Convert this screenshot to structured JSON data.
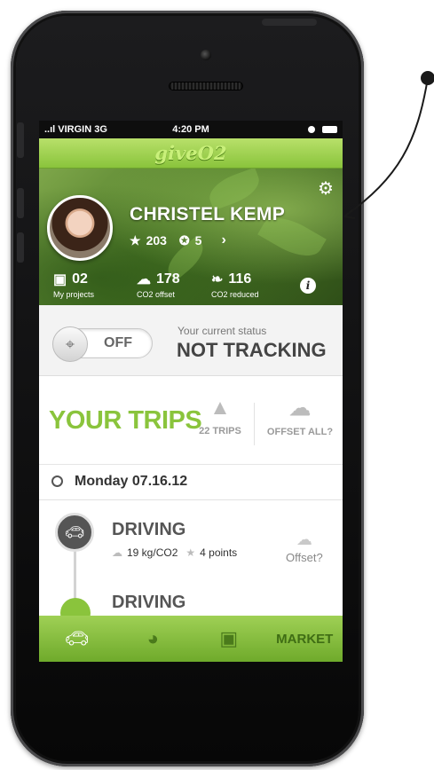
{
  "status_bar": {
    "carrier": "..ıl VIRGIN 3G",
    "time": "4:20 PM"
  },
  "app": {
    "logo": "giveO2"
  },
  "profile": {
    "name": "CHRISTEL KEMP",
    "stars": "203",
    "badges": "5",
    "stats": [
      {
        "value": "02",
        "label": "My projects",
        "icon": "camera-icon"
      },
      {
        "value": "178",
        "label": "CO2 offset",
        "icon": "cloud-icon"
      },
      {
        "value": "116",
        "label": "CO2 reduced",
        "icon": "leaf-icon"
      }
    ]
  },
  "tracking": {
    "toggle_label": "OFF",
    "status_caption": "Your current status",
    "status_value": "NOT TRACKING"
  },
  "trips": {
    "title": "YOUR TRIPS",
    "count_label": "22 TRIPS",
    "offset_all_label": "OFFSET ALL?",
    "date": "Monday 07.16.12",
    "items": [
      {
        "type": "DRIVING",
        "co2": "19 kg/CO2",
        "points": "4 points",
        "offset_label": "Offset?"
      },
      {
        "type": "DRIVING"
      }
    ]
  },
  "tabbar": {
    "market_label": "MARKET"
  }
}
